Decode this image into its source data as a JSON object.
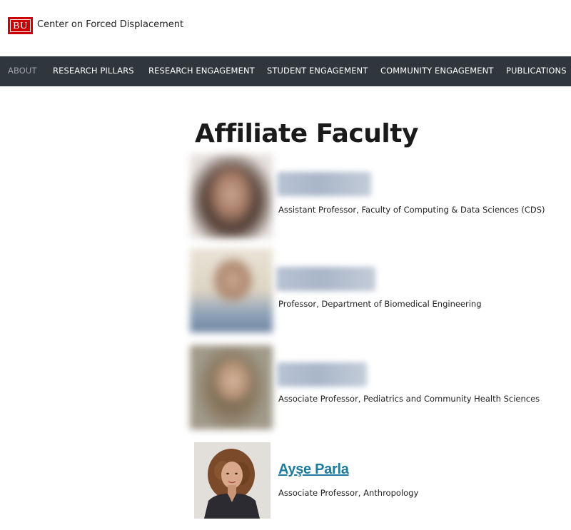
{
  "header": {
    "logo_text": "BU",
    "site_title": "Center on Forced Displacement"
  },
  "nav": {
    "items": [
      {
        "label": "About",
        "active": true
      },
      {
        "label": "Research Pillars",
        "active": false
      },
      {
        "label": "Research Engagement",
        "active": false
      },
      {
        "label": "Student Engagement",
        "active": false
      },
      {
        "label": "Community Engagement",
        "active": false
      },
      {
        "label": "Publications",
        "active": false
      }
    ]
  },
  "page": {
    "title": "Affiliate Faculty"
  },
  "faculty": [
    {
      "name": "",
      "title": "Assistant Professor, Faculty of Computing & Data Sciences (CDS)"
    },
    {
      "name": "",
      "title": "Professor, Department of Biomedical Engineering"
    },
    {
      "name": "",
      "title": "Associate Professor, Pediatrics and Community Health Sciences"
    },
    {
      "name": "Ayşe Parla",
      "title": "Associate Professor, Anthropology"
    }
  ],
  "colors": {
    "nav_bg": "#2f373d",
    "nav_active": "#9ea3a7",
    "link": "#1e7b9c",
    "brand_red": "#cc0000"
  }
}
